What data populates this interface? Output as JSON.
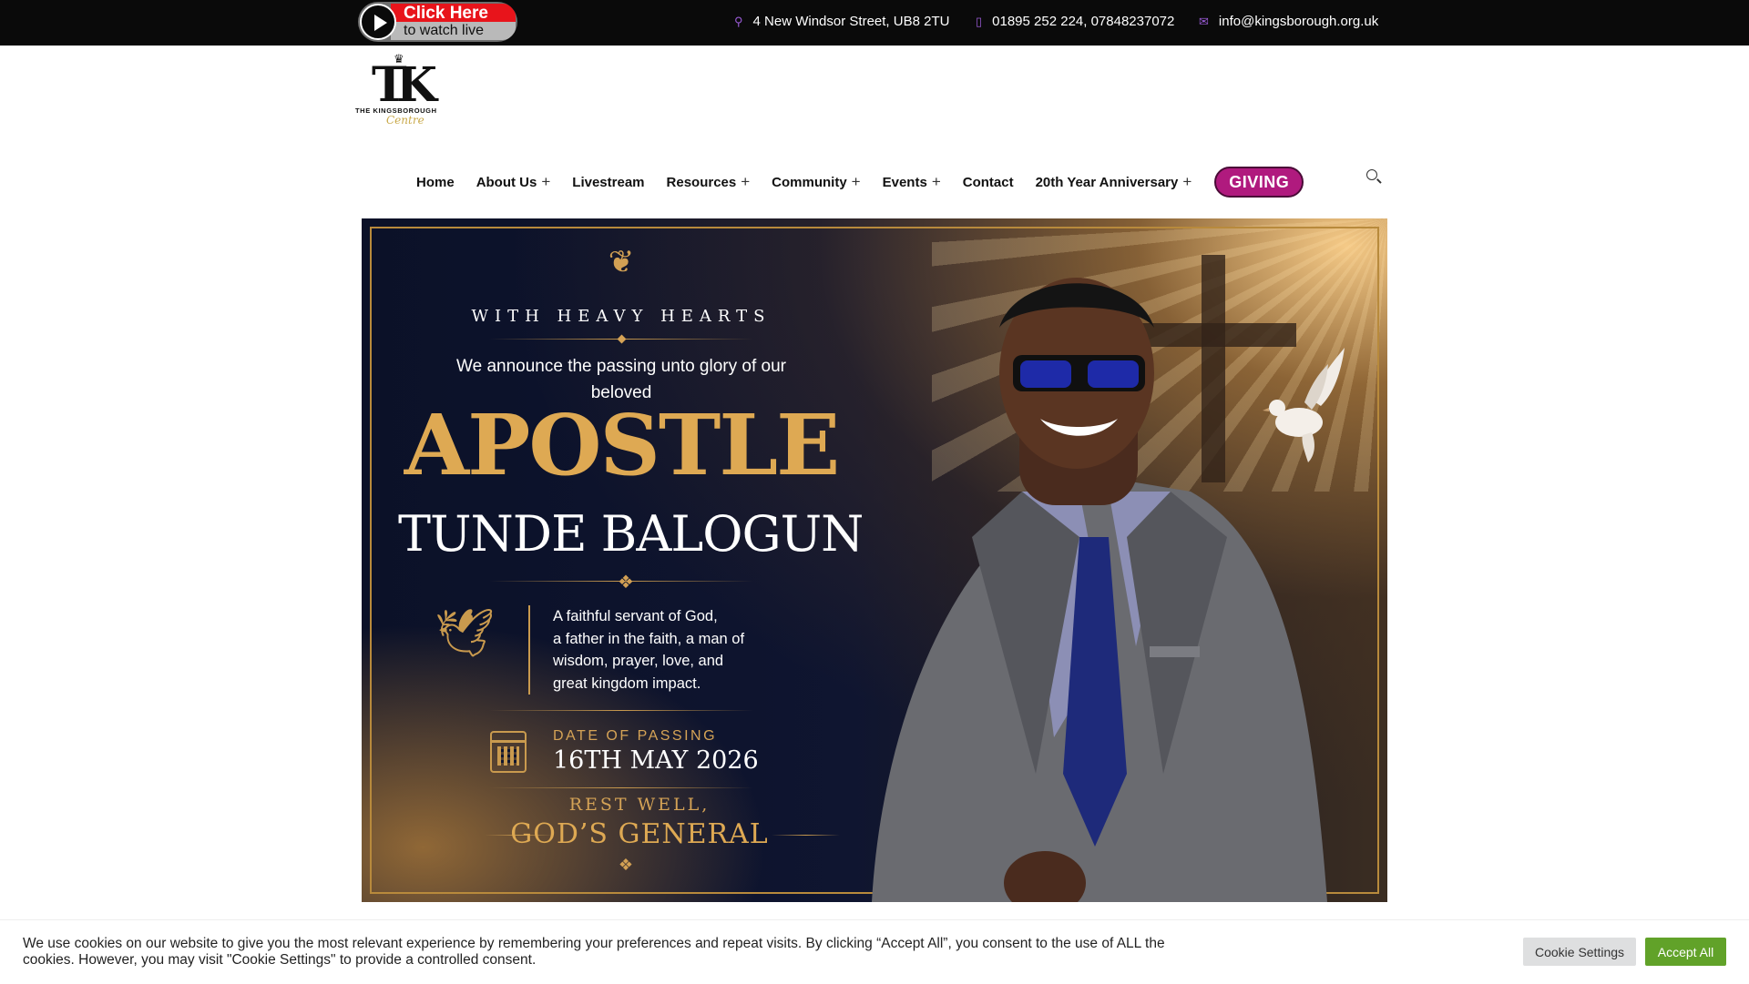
{
  "topbar": {
    "live_button": {
      "line1": "Click Here",
      "line2": "to watch live"
    },
    "address": "4 New Windsor Street, UB8 2TU",
    "phone": "01895 252 224, 07848237072",
    "email": "info@kingsborough.org.uk",
    "icons": [
      "map-pin-icon",
      "phone-icon",
      "envelope-icon"
    ]
  },
  "logo": {
    "name": "THE KINGSBOROUGH",
    "script": "Centre"
  },
  "nav": {
    "items": [
      {
        "label": "Home",
        "has_submenu": false
      },
      {
        "label": "About Us",
        "has_submenu": true
      },
      {
        "label": "Livestream",
        "has_submenu": false
      },
      {
        "label": "Resources",
        "has_submenu": true
      },
      {
        "label": "Community",
        "has_submenu": true
      },
      {
        "label": "Events",
        "has_submenu": true
      },
      {
        "label": "Contact",
        "has_submenu": false
      },
      {
        "label": "20th Year Anniversary",
        "has_submenu": true
      }
    ],
    "submenu_symbol": "+",
    "giving_label": "GIVING",
    "search_icon": "search-icon"
  },
  "hero": {
    "heading": "WITH HEAVY HEARTS",
    "announce": "We announce the passing unto glory of our beloved",
    "title": "APOSTLE",
    "name": "TUNDE BALOGUN",
    "tribute": "A faithful servant of God,\na father in the faith, a man of\nwisdom, prayer, love, and\ngreat kingdom impact.",
    "date_label": "DATE OF PASSING",
    "date": "16TH MAY 2026",
    "rest": "REST WELL,",
    "general": "GOD’S GENERAL"
  },
  "cookie": {
    "text": "We use cookies on our website to give you the most relevant experience by remembering your preferences and repeat visits. By clicking “Accept All”, you consent to the use of ALL the cookies. However, you may visit \"Cookie Settings\" to provide a controlled consent.",
    "settings_label": "Cookie Settings",
    "accept_label": "Accept All"
  },
  "colors": {
    "topbar": "#0a0a0a",
    "accent_icon": "#9a5bd6",
    "giving": "#b01a7e",
    "gold": "#dea953",
    "navy": "#0b1128",
    "accept": "#61a229"
  }
}
